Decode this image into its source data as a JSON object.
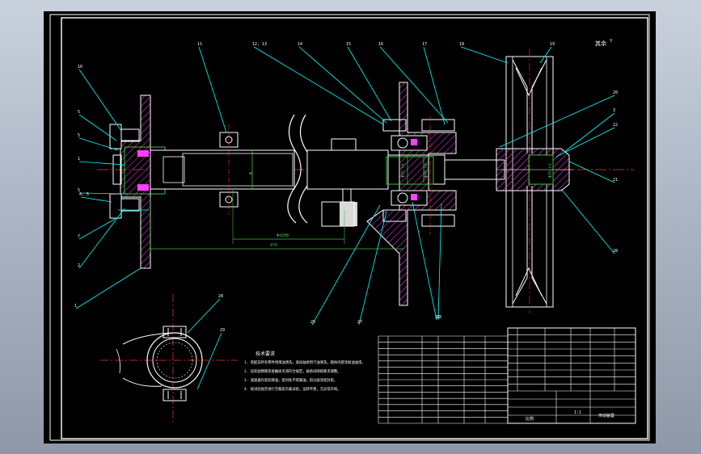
{
  "drawing": {
    "balloon_labels": [
      "10",
      "5",
      "5",
      "1",
      "5",
      "4, 5",
      "7",
      "2",
      "1",
      "11",
      "12, 13",
      "14",
      "15",
      "16",
      "17",
      "18",
      "19",
      "20",
      "3",
      "22",
      "21",
      "28",
      "26",
      "23",
      "25",
      "27",
      "28",
      "29",
      "3"
    ],
    "dimensions": {
      "fit_bore": "Φ42H8",
      "overall_length": "470",
      "shaft_dia_left": "Φ",
      "shaft_dia_mid": "Φ35 h6",
      "shaft_dia_bearing": "Φ40 k6",
      "shaft_dia_pulley": "Φ35 h7"
    },
    "technical_requirements": {
      "heading": "技术要求",
      "lines": [
        "1. 装配前所有零件用煤油清洗，滚动轴承用汽油清洗，箱体内壁涂耐油油漆。",
        "2. 齿轮副侧隙及接触斑点须符合规定，轴承间隙按要求调整。",
        "3. 减速器内装润滑油，密封处不得漏油，剖分面涂密封胶。",
        "4. 按试验规范进行空载及负载试验，运转平稳，无异常声响。"
      ]
    },
    "title_block": {
      "scale_label": "比例",
      "scale_value": "1:1",
      "drawing_name": "传动装置"
    },
    "roughness_note": "其余"
  }
}
